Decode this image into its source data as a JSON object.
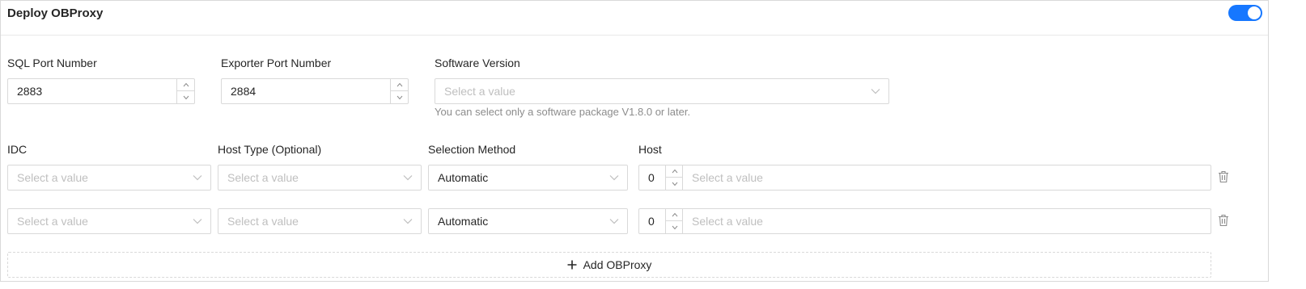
{
  "header": {
    "title": "Deploy OBProxy",
    "toggle_on": true,
    "accent_color": "#1677ff"
  },
  "ports": {
    "sql_label": "SQL Port Number",
    "sql_value": "2883",
    "exporter_label": "Exporter Port Number",
    "exporter_value": "2884",
    "software_label": "Software Version",
    "software_placeholder": "Select a value",
    "software_hint": "You can select only a software package V1.8.0 or later."
  },
  "columns": {
    "idc": "IDC",
    "host_type": "Host Type (Optional)",
    "selection_method": "Selection Method",
    "host": "Host"
  },
  "rows": [
    {
      "idc_placeholder": "Select a value",
      "host_type_placeholder": "Select a value",
      "selection_method": "Automatic",
      "host_count": "0",
      "host_placeholder": "Select a value"
    },
    {
      "idc_placeholder": "Select a value",
      "host_type_placeholder": "Select a value",
      "selection_method": "Automatic",
      "host_count": "0",
      "host_placeholder": "Select a value"
    }
  ],
  "add_button_label": "Add OBProxy",
  "icons": {
    "stepper_up": "chevron-up-icon",
    "stepper_down": "chevron-down-icon",
    "select_arrow": "chevron-down-icon",
    "delete": "trash-icon",
    "add": "plus-icon"
  }
}
